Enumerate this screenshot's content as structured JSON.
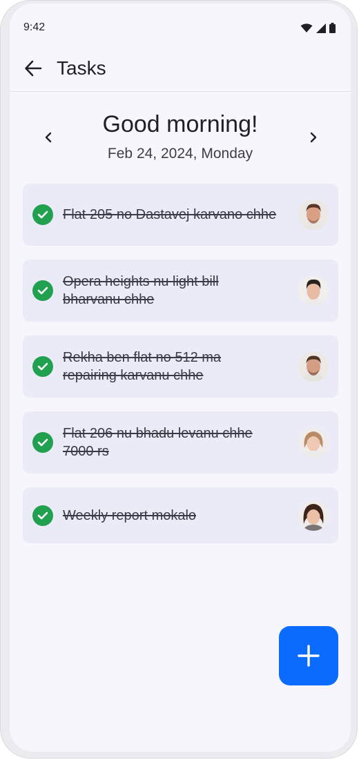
{
  "status_bar": {
    "time": "9:42",
    "icons": [
      "wifi-icon",
      "cellular-icon",
      "battery-icon"
    ]
  },
  "app_bar": {
    "back_icon": "arrow-left-icon",
    "title": "Tasks"
  },
  "header": {
    "greeting": "Good morning!",
    "date": "Feb 24, 2024, Monday",
    "prev_icon": "chevron-left-icon",
    "next_icon": "chevron-right-icon"
  },
  "tasks": [
    {
      "text": "Flat 205 no Dastavej karvano chhe",
      "completed": true,
      "assignee_avatar": "man-avatar"
    },
    {
      "text": "Opera heights nu light bill bharvanu chhe",
      "completed": true,
      "assignee_avatar": "young-man-avatar"
    },
    {
      "text": "Rekha ben flat no 512 ma repairing karvanu chhe",
      "completed": true,
      "assignee_avatar": "man-avatar"
    },
    {
      "text": "Flat 206 nu bhadu levanu chhe 7000 rs",
      "completed": true,
      "assignee_avatar": "woman-avatar"
    },
    {
      "text": "Weekly report mokalo",
      "completed": true,
      "assignee_avatar": "woman-dark-hair-avatar"
    }
  ],
  "fab": {
    "icon": "plus-icon"
  },
  "colors": {
    "accent": "#0b6bff",
    "check": "#21a14f",
    "card_bg": "#ebebf7",
    "screen_bg": "#f6f6fc"
  }
}
